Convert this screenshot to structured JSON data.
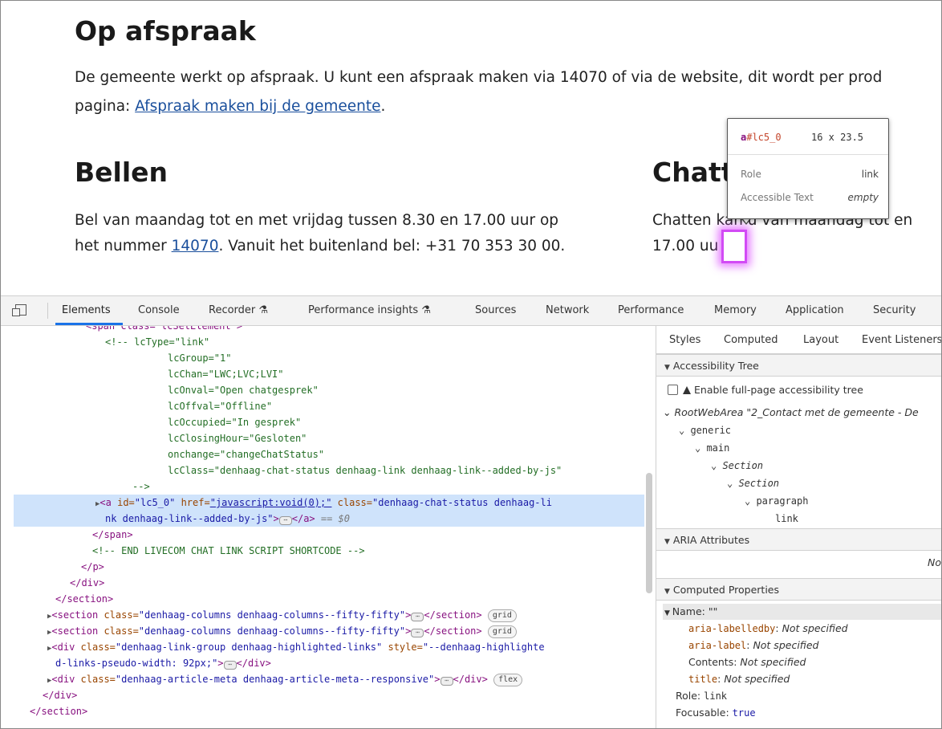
{
  "page": {
    "heading1": "Op afspraak",
    "intro_line1": "De gemeente werkt op afspraak. U kunt een afspraak maken via 14070 of via de website, dit wordt per prod",
    "intro_line2_prefix": "pagina: ",
    "intro_link": "Afspraak maken bij de gemeente",
    "intro_line2_suffix": ".",
    "col1": {
      "heading": "Bellen",
      "line1": "Bel van maandag tot en met vrijdag tussen 8.30 en 17.00 uur op",
      "line2_prefix": "het nummer ",
      "line2_link": "14070",
      "line2_suffix": ". Vanuit het buitenland bel: +31 70 353 30 00."
    },
    "col2": {
      "heading": "Chatt",
      "line1": "Chatten kan u van maandag tot en",
      "line2": "17.00 uu"
    }
  },
  "tooltip": {
    "selector_tag": "a",
    "selector_id": "#lc5_0",
    "dimensions": "16 x 23.5",
    "role_label": "Role",
    "role_value": "link",
    "acc_label": "Accessible Text",
    "acc_value": "empty"
  },
  "devtools": {
    "tabs": [
      "Elements",
      "Console",
      "Recorder ⚗",
      "Performance insights ⚗",
      "Sources",
      "Network",
      "Performance",
      "Memory",
      "Application",
      "Security"
    ],
    "code": {
      "l0": "<span class=\"lcSetElement\">",
      "l1": "<!-- lcType=\"link\"",
      "l2": "lcGroup=\"1\"",
      "l3": "lcChan=\"LWC;LVC;LVI\"",
      "l4": "lcOnval=\"Open chatgesprek\"",
      "l5": "lcOffval=\"Offline\"",
      "l6": "lcOccupied=\"In gesprek\"",
      "l7": "lcClosingHour=\"Gesloten\"",
      "l8": "onchange=\"changeChatStatus\"",
      "l9": "lcClass=\"denhaag-chat-status denhaag-link denhaag-link--added-by-js\"",
      "l10": "-->",
      "sel_a_open": "<a",
      "sel_attr_id": " id=",
      "sel_val_id": "\"lc5_0\"",
      "sel_attr_href": " href=",
      "sel_val_href": "\"javascript:void(0);\"",
      "sel_attr_class": " class=",
      "sel_val_class_1": "\"denhaag-chat-status denhaag-li",
      "sel_val_class_2": "nk denhaag-link--added-by-js\"",
      "sel_close": "></a>",
      "sel_eq": " == $0",
      "l13": "</span>",
      "l14": "<!-- END LIVECOM CHAT LINK SCRIPT SHORTCODE -->",
      "l15": "</p>",
      "l16": "</div>",
      "l17": "</section>",
      "s1_tag": "<section",
      "s1_attr": " class=",
      "s1_val": "\"denhaag-columns denhaag-columns--fifty-fifty\"",
      "s1_end": "></section>",
      "badge_grid": "grid",
      "d1_tag": "<div",
      "d1_attr": " class=",
      "d1_val": "\"denhaag-link-group denhaag-highlighted-links\"",
      "d1_attr2": " style=",
      "d1_val2a": "\"--denhaag-highlighte",
      "d1_val2b": "d-links-pseudo-width: 92px;\"",
      "d1_end": "></div>",
      "d2_tag": "<div",
      "d2_attr": " class=",
      "d2_val": "\"denhaag-article-meta denhaag-article-meta--responsive\"",
      "d2_end": "></div>",
      "badge_flex": "flex",
      "l24": "</div>",
      "l25": "</section>"
    },
    "side_tabs": [
      "Styles",
      "Computed",
      "Layout",
      "Event Listeners"
    ],
    "acc_tree_title": "Accessibility Tree",
    "enable_full": "Enable full-page accessibility tree",
    "tree": {
      "root": "RootWebArea \"2_Contact met de gemeente - De",
      "generic": "generic",
      "main": "main",
      "section1": "Section",
      "section2": "Section",
      "paragraph": "paragraph",
      "link": "link"
    },
    "aria_title": "ARIA Attributes",
    "aria_value": "No",
    "computed_title": "Computed Properties",
    "name_row": "Name: \"\"",
    "props": {
      "labelledby_k": "aria-labelledby",
      "labelledby_v": "Not specified",
      "label_k": "aria-label",
      "label_v": "Not specified",
      "contents_k": "Contents",
      "contents_v": "Not specified",
      "title_k": "title",
      "title_v": "Not specified",
      "role_k": "Role: ",
      "role_v": "link",
      "focusable_k": "Focusable: ",
      "focusable_v": "true"
    }
  },
  "colors": {
    "highlight": "#d24bf5",
    "selection": "#cfe3fb",
    "link": "#1a4f9c",
    "active_tab": "#1a73e8"
  }
}
